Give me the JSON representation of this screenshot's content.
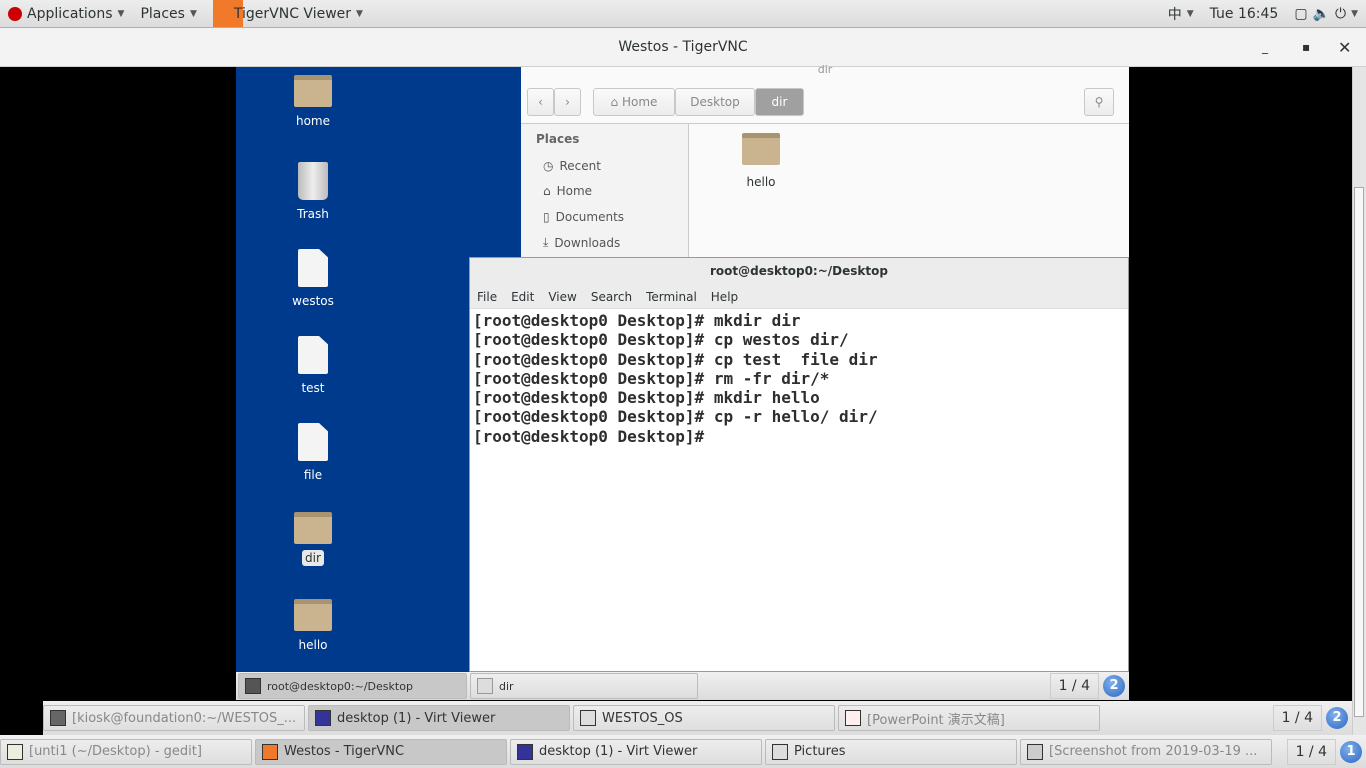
{
  "topbar": {
    "applications": "Applications",
    "places": "Places",
    "app": "TigerVNC Viewer",
    "input": "中",
    "clock": "Tue 16:45"
  },
  "window": {
    "title": "Westos - TigerVNC"
  },
  "desktop_icons": [
    {
      "label": "home",
      "type": "folder"
    },
    {
      "label": "Trash",
      "type": "trash"
    },
    {
      "label": "westos",
      "type": "doc"
    },
    {
      "label": "test",
      "type": "doc"
    },
    {
      "label": "file",
      "type": "doc"
    },
    {
      "label": "dir",
      "type": "folder"
    },
    {
      "label": "hello",
      "type": "folder"
    }
  ],
  "nautilus": {
    "title": "dir",
    "breadcrumb": [
      "Home",
      "Desktop",
      "dir"
    ],
    "places_header": "Places",
    "places": [
      "Recent",
      "Home",
      "Documents",
      "Downloads"
    ],
    "files": [
      "hello"
    ]
  },
  "terminal": {
    "title": "root@desktop0:~/Desktop",
    "menu": [
      "File",
      "Edit",
      "View",
      "Search",
      "Terminal",
      "Help"
    ],
    "lines": [
      "[root@desktop0 Desktop]# mkdir dir",
      "[root@desktop0 Desktop]# cp westos dir/",
      "[root@desktop0 Desktop]# cp test  file dir",
      "[root@desktop0 Desktop]# rm -fr dir/*",
      "[root@desktop0 Desktop]# mkdir hello",
      "[root@desktop0 Desktop]# cp -r hello/ dir/",
      "[root@desktop0 Desktop]# "
    ]
  },
  "remote_taskbar": {
    "tasks": [
      "root@desktop0:~/Desktop",
      "dir"
    ],
    "pager": "1 / 4",
    "workspace": "2"
  },
  "mid_taskbar": {
    "tasks": [
      "[kiosk@foundation0:~/WESTOS_...",
      "desktop (1) - Virt Viewer",
      "WESTOS_OS",
      "[PowerPoint 演示文稿]"
    ],
    "pager": "1 / 4",
    "workspace": "2"
  },
  "host_taskbar": {
    "tasks": [
      "[unti1 (~/Desktop) - gedit]",
      "Westos - TigerVNC",
      "desktop (1) - Virt Viewer",
      "Pictures",
      "[Screenshot from 2019-03-19 ..."
    ],
    "pager": "1 / 4",
    "workspace": "1"
  }
}
